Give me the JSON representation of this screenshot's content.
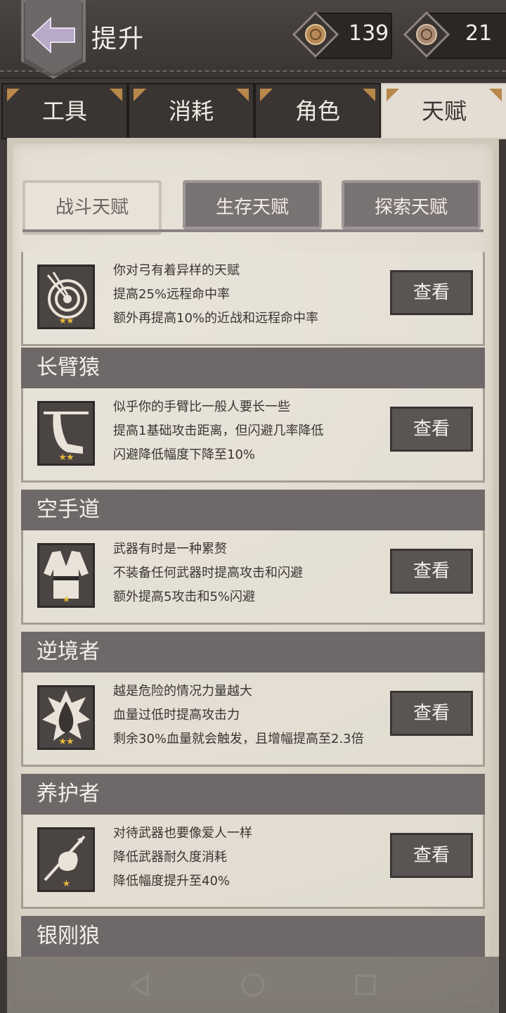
{
  "header": {
    "title": "提升",
    "currency_1": "139",
    "currency_2": "21"
  },
  "tabs": [
    {
      "label": "工具"
    },
    {
      "label": "消耗"
    },
    {
      "label": "角色"
    },
    {
      "label": "天赋"
    }
  ],
  "subtabs": [
    {
      "label": "战斗天赋"
    },
    {
      "label": "生存天赋"
    },
    {
      "label": "探索天赋"
    }
  ],
  "talents": [
    {
      "name": "",
      "lines": [
        "你对弓有着异样的天赋",
        "提高25%远程命中率",
        "额外再提高10%的近战和远程命中率"
      ],
      "button": "查看",
      "stars": "★★",
      "icon": "archery-target-icon"
    },
    {
      "name": "长臂猿",
      "lines": [
        "似乎你的手臂比一般人要长一些",
        "提高1基础攻击距离，但闪避几率降低",
        "闪避降低幅度下降至10%"
      ],
      "button": "查看",
      "stars": "★★",
      "icon": "long-arm-icon"
    },
    {
      "name": "空手道",
      "lines": [
        "武器有时是一种累赘",
        "不装备任何武器时提高攻击和闪避",
        "额外提高5攻击和5%闪避"
      ],
      "button": "查看",
      "stars": "★",
      "icon": "karate-gi-icon"
    },
    {
      "name": "逆境者",
      "lines": [
        "越是危险的情况力量越大",
        "血量过低时提高攻击力",
        "剩余30%血量就会触发，且增幅提高至2.3倍"
      ],
      "button": "查看",
      "stars": "★★",
      "icon": "blood-drop-icon"
    },
    {
      "name": "养护者",
      "lines": [
        "对待武器也要像爱人一样",
        "降低武器耐久度消耗",
        "降低幅度提升至40%"
      ],
      "button": "查看",
      "stars": "★",
      "icon": "spear-hand-icon"
    },
    {
      "name": "银刚狼",
      "lines": [],
      "button": "",
      "stars": "",
      "icon": ""
    }
  ]
}
